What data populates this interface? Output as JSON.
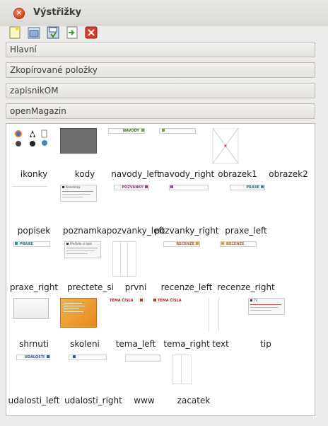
{
  "window": {
    "title": "Výstřižky",
    "close_glyph": "×"
  },
  "toolbar": {
    "buttons": [
      {
        "name": "new-icon",
        "color": "#f3e9a0"
      },
      {
        "name": "open-icon",
        "color": "#8aaed8"
      },
      {
        "name": "save-icon",
        "color": "#6a93c9"
      },
      {
        "name": "export-icon",
        "color": "#6cb05b"
      },
      {
        "name": "delete-icon",
        "color": "#d83a2e"
      }
    ]
  },
  "sections": [
    {
      "label": "Hlavní"
    },
    {
      "label": "Zkopírované položky"
    },
    {
      "label": "zapisnikOM"
    },
    {
      "label": "openMagazin"
    }
  ],
  "items": [
    {
      "label": "ikonky"
    },
    {
      "label": "kody"
    },
    {
      "label": "navody_left",
      "tag": "NAVODY"
    },
    {
      "label": "navody_right"
    },
    {
      "label": "obrazek1"
    },
    {
      "label": "obrazek2"
    },
    {
      "label": "popisek"
    },
    {
      "label": "poznamka",
      "tag": "Poznámka"
    },
    {
      "label": "pozvanky_left",
      "tag": "POZVÁNKY"
    },
    {
      "label": "pozvanky_right"
    },
    {
      "label": "praxe_left",
      "tag": "PRAXE"
    },
    {
      "label": "praxe_right",
      "tag": "PRAXE"
    },
    {
      "label": "prectete_si",
      "tag": "Přečtěte si také"
    },
    {
      "label": "prvni"
    },
    {
      "label": "recenze_left",
      "tag": "RECENZE"
    },
    {
      "label": "recenze_right",
      "tag": "RECENZE"
    },
    {
      "label": "shrnuti"
    },
    {
      "label": "skoleni"
    },
    {
      "label": "tema_left",
      "tag": "TÉMA ČÍSLA"
    },
    {
      "label": "tema_right",
      "tag": "TÉMA ČÍSLA"
    },
    {
      "label": "text"
    },
    {
      "label": "tip",
      "tag": "TV"
    },
    {
      "label": "udalosti_left",
      "tag": "UDÁLOSTI"
    },
    {
      "label": "udalosti_right"
    },
    {
      "label": "www"
    },
    {
      "label": "zacatek"
    }
  ]
}
